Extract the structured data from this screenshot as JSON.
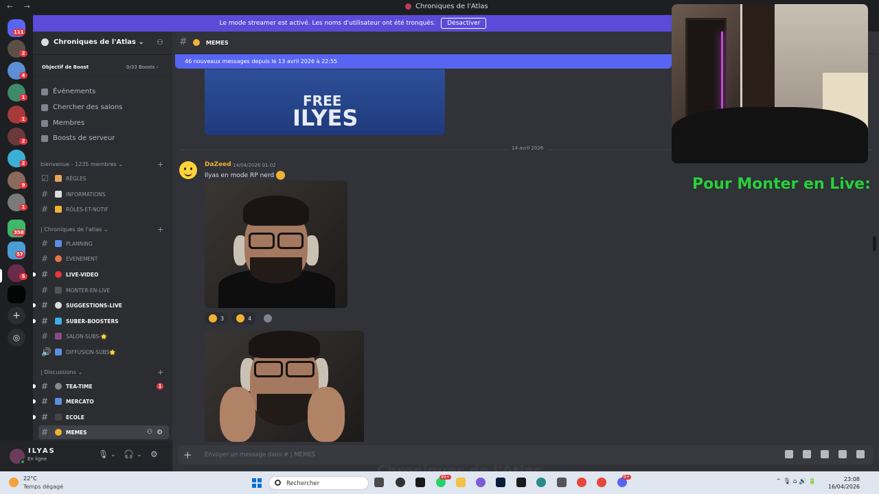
{
  "window": {
    "title": "Chroniques de l'Atlas",
    "nav": "← →"
  },
  "streamer_banner": {
    "text": "Le mode streamer est activé. Les noms d'utilisateur ont été tronqués.",
    "button": "Désactiver"
  },
  "guilds": {
    "home_badge": "111",
    "items": [
      {
        "badge": "2"
      },
      {
        "badge": "4"
      },
      {
        "badge": "1"
      },
      {
        "badge": "1"
      },
      {
        "badge": "2"
      },
      {
        "badge": "2"
      },
      {
        "badge": "9"
      },
      {
        "badge": "1"
      },
      {
        "badge": "358"
      },
      {
        "badge": "57"
      },
      {
        "badge": "5"
      }
    ],
    "add_server": "+",
    "discover": "◎"
  },
  "server": {
    "name": "Chroniques de l'Atlas ⌄",
    "boost_label": "Objectif de Boost",
    "boost_count": "0/33 Boosts ›",
    "menu": [
      "Événements",
      "Chercher des salons",
      "Membres",
      "Boosts de serveur"
    ]
  },
  "categories": [
    {
      "label": "bienvenue - 1235 membres ⌄"
    },
    {
      "label": "| Chroniques de l'atlas ⌄"
    },
    {
      "label": "| Discussions ⌄"
    }
  ],
  "channels": [
    {
      "name": "RÈGLES",
      "prefix": "☑"
    },
    {
      "name": "INFORMATIONS",
      "prefix": "#"
    },
    {
      "name": "RÔLES-ET-NOTIF",
      "prefix": "#"
    },
    {
      "name": "PLANNING",
      "prefix": "#"
    },
    {
      "name": "EVENEMENT",
      "prefix": "#"
    },
    {
      "name": "LIVE-VIDEO",
      "prefix": "#"
    },
    {
      "name": "MONTER-EN-LIVE",
      "prefix": "#"
    },
    {
      "name": "SUGGESTIONS-LIVE",
      "prefix": "#"
    },
    {
      "name": "SUBER-BOOSTERS",
      "prefix": "#"
    },
    {
      "name": "SALON-SUBS-🌟",
      "prefix": "#"
    },
    {
      "name": "DIFFUSION-SUBS🌟",
      "prefix": "🔊"
    },
    {
      "name": "TEA-TIME",
      "prefix": "#",
      "badge": "1"
    },
    {
      "name": "MERCATO",
      "prefix": "#"
    },
    {
      "name": "ECOLE",
      "prefix": "#"
    },
    {
      "name": "MEMES",
      "prefix": "#"
    }
  ],
  "user": {
    "name": "ILYAS",
    "status": "En ligne"
  },
  "chat": {
    "channel_name": "MEMES",
    "new_messages": "46 nouveaux messages depuis le 13 avril 2026 à 22:55",
    "image_text": [
      "FREE",
      "ILYES"
    ],
    "date_divider": "14 avril 2026",
    "message": {
      "author": "DaZeed",
      "time": "14/04/2026 01:02",
      "text": "Ilyas en mode RP nerd"
    },
    "reactions": [
      {
        "count": "3"
      },
      {
        "count": "4"
      }
    ],
    "composer_placeholder": "Envoyer un message dans #",
    "composer_channel": "| MEMES",
    "watermark": "Chroniques de l'Atlas"
  },
  "overlay_text": "Pour Monter en Live:",
  "taskbar": {
    "temp": "22°C",
    "weather": "Temps dégagé",
    "search": "Rechercher",
    "time": "23:08",
    "date": "16/04/2026",
    "badges": [
      "99+",
      "9+"
    ]
  },
  "colors": {
    "accent": "#5865f2",
    "streamer": "#5b4bd8",
    "author": "#f0b232",
    "overlay": "#2ecc40"
  }
}
